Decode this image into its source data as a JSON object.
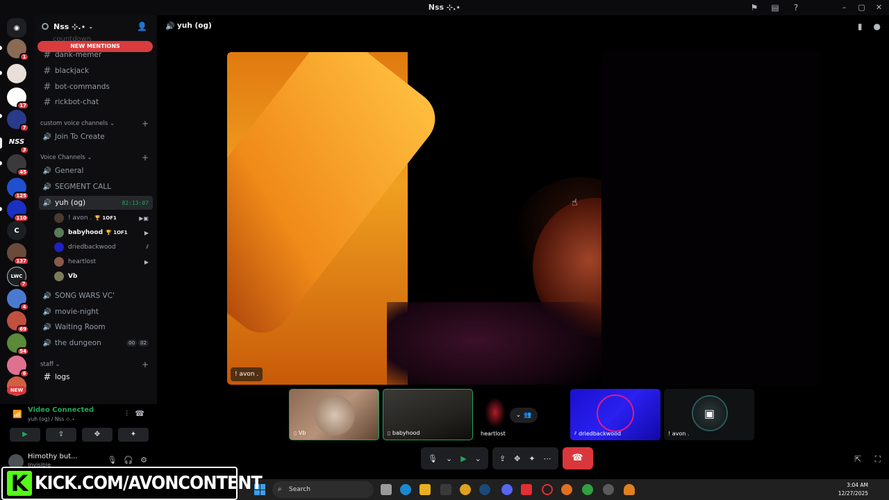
{
  "titlebar": {
    "title": "Nss ⊹.⋆"
  },
  "rail": [
    {
      "label": "",
      "color": "#5865f2",
      "badge": "",
      "top": 0
    },
    {
      "label": "",
      "color": "#8a6a52",
      "badge": "1"
    },
    {
      "label": "",
      "color": "#e8e0d8",
      "badge": ""
    },
    {
      "label": "",
      "color": "#ffffff",
      "badge": "17"
    },
    {
      "label": "",
      "color": "#2a3a8a",
      "badge": "7"
    },
    {
      "label": "NSS",
      "color": "#0b0b0d",
      "badge": "3"
    },
    {
      "label": "",
      "color": "#3a3a3a",
      "badge": "45"
    },
    {
      "label": "",
      "color": "#2050d0",
      "badge": "125"
    },
    {
      "label": "",
      "color": "#1a30c0",
      "badge": "110"
    },
    {
      "label": "C",
      "color": "#1e1f22",
      "badge": ""
    },
    {
      "label": "",
      "color": "#6a4a3a",
      "badge": "137"
    },
    {
      "label": "LWC",
      "color": "#1e1f22",
      "badge": "7"
    },
    {
      "label": "",
      "color": "#4a7ad0",
      "badge": "4"
    },
    {
      "label": "",
      "color": "#c05040",
      "badge": "69"
    },
    {
      "label": "",
      "color": "#5a8a3a",
      "badge": "54"
    },
    {
      "label": "",
      "color": "#e07090",
      "badge": "6"
    },
    {
      "label": "",
      "color": "#d06040",
      "badge": "NEW"
    }
  ],
  "sidebar": {
    "guild_name": "Nss ⊹.⋆",
    "new_mentions": "NEW MENTIONS",
    "partial_channel": "countdown",
    "text_channels": [
      "dank-memer",
      "blackjack",
      "bot-commands",
      "rickbot-chat"
    ],
    "cat_custom": "custom voice channels",
    "join_to_create": "Join To Create",
    "cat_voice": "Voice Channels",
    "voice_channels_top": [
      "General",
      "SEGMENT CALL"
    ],
    "active_channel": {
      "name": "yuh (og)",
      "timer": "82:13:07"
    },
    "voice_users": [
      {
        "name": "! avon .",
        "tag": "🏆 1OF1",
        "icon": "📹",
        "color": "#4a3a30",
        "bold": false
      },
      {
        "name": "babyhood",
        "tag": "🏆 1OF1",
        "icon": "📹",
        "color": "#5a7a5a",
        "bold": true
      },
      {
        "name": "driedbackwood",
        "tag": "",
        "icon": "⫽",
        "color": "#2020c0",
        "bold": false
      },
      {
        "name": "heartlost",
        "tag": "",
        "icon": "📹",
        "color": "#8a5a4a",
        "bold": false
      },
      {
        "name": "Vb",
        "tag": "",
        "icon": "",
        "color": "#7a7a5a",
        "bold": true
      }
    ],
    "voice_channels_bottom": [
      "SONG WARS VC'",
      "movie-night",
      "Waiting Room"
    ],
    "dungeon": {
      "name": "the dungeon",
      "count_a": "00",
      "count_b": "02"
    },
    "cat_staff": "staff",
    "logs": "logs"
  },
  "voice_panel": {
    "status": "Video Connected",
    "sub": "yuh (og) / Nss ⊹.⋆"
  },
  "user": {
    "name": "Himothy but...",
    "status": "Invisible"
  },
  "main": {
    "channel_name": "yuh (og)",
    "stage_label": "! avon .",
    "tiles": [
      {
        "name": "Vb",
        "mobile": "▯"
      },
      {
        "name": "babyhood",
        "mobile": "▯"
      },
      {
        "name": "heartlost",
        "mobile": ""
      },
      {
        "name": "driedbackwood",
        "mobile": "⫽"
      },
      {
        "name": "! avon .",
        "mobile": ""
      }
    ]
  },
  "taskbar": {
    "search": "Search",
    "time": "3:04 AM",
    "date": "12/27/2025"
  },
  "watermark": {
    "letter": "K",
    "text": "KICK.COM/AVONCONTENT"
  },
  "colors": {
    "accent_green": "#23a55a",
    "danger": "#da373c",
    "mention": "#d83c3e"
  }
}
